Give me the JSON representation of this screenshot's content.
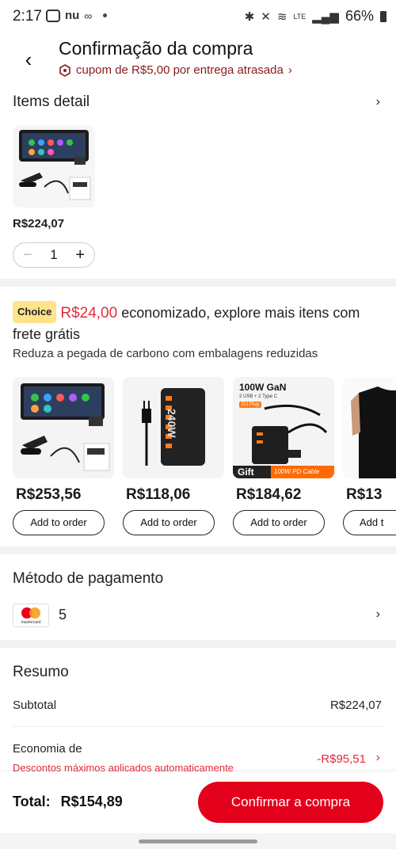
{
  "status_bar": {
    "time": "2:17",
    "app_text": "nu",
    "battery": "66%",
    "lte": "LTE"
  },
  "header": {
    "back_glyph": "‹",
    "title": "Confirmação da compra",
    "coupon": "cupom de R$5,00 por entrega atrasada",
    "coupon_chevron": "›"
  },
  "items": {
    "title": "Items detail",
    "price": "R$224,07",
    "quantity": "1",
    "minus": "−",
    "plus": "+"
  },
  "choice": {
    "badge": "Choice",
    "saved_amount": "R$24,00",
    "rest": " economizado, explore mais itens com frete grátis",
    "subtitle": "Reduza a pegada de carbono com embalagens reduzidas",
    "products": [
      {
        "price": "R$253,56",
        "button": "Add to order"
      },
      {
        "price": "R$118,06",
        "button": "Add to order",
        "image_text": "240W"
      },
      {
        "price": "R$184,62",
        "button": "Add to order",
        "image_text": "100W GaN",
        "image_sub": "2 USB + 2 Type C",
        "image_tag": "EU Plug",
        "gift": "Gift",
        "gift_cable": "100W PD Cable"
      },
      {
        "price": "R$13",
        "button": "Add t"
      }
    ]
  },
  "payment": {
    "title": "Método de pagamento",
    "card_brand": "mastercard",
    "card_number": "5"
  },
  "summary": {
    "title": "Resumo",
    "subtotal_label": "Subtotal",
    "subtotal_value": "R$224,07",
    "savings_label": "Economia de",
    "savings_value": "-R$95,51",
    "savings_note": "Descontos máximos aplicados automaticamente"
  },
  "bottom": {
    "total_label": "Total:",
    "total_value": "R$154,89",
    "confirm": "Confirmar a compra"
  },
  "colors": {
    "accent": "#e3001b",
    "saved": "#e5293d",
    "choice_badge": "#ffe38a"
  }
}
